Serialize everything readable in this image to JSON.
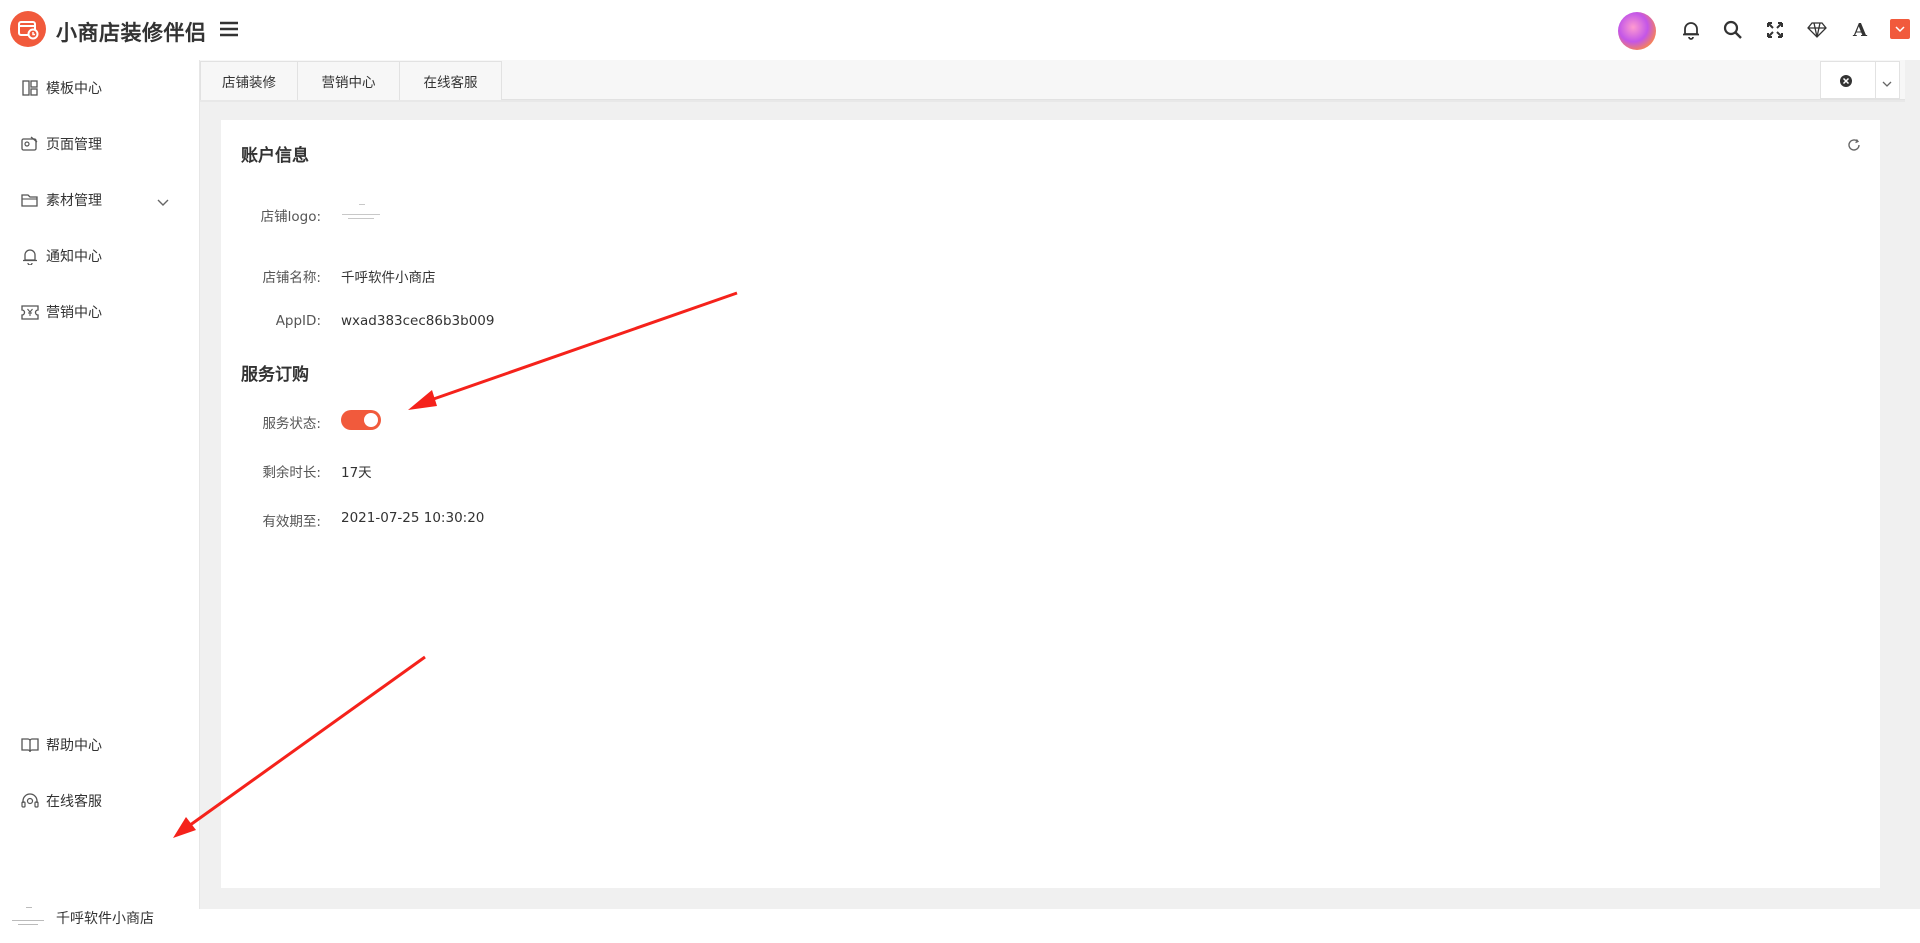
{
  "app": {
    "title": "小商店装修伴侣",
    "accent": "#f15a3c"
  },
  "header": {
    "icons": [
      "menu-toggle-icon",
      "avatar",
      "bell-icon",
      "search-icon",
      "fullscreen-icon",
      "diamond-icon",
      "font-icon",
      "theme-color-icon"
    ]
  },
  "sidebar": {
    "items": [
      {
        "label": "模板中心",
        "icon": "template-icon"
      },
      {
        "label": "页面管理",
        "icon": "page-icon"
      },
      {
        "label": "素材管理",
        "icon": "folder-icon",
        "has_children": true
      },
      {
        "label": "通知中心",
        "icon": "bell-icon"
      },
      {
        "label": "营销中心",
        "icon": "coupon-icon"
      }
    ],
    "bottom": [
      {
        "label": "帮助中心",
        "icon": "book-icon"
      },
      {
        "label": "在线客服",
        "icon": "headset-icon"
      }
    ],
    "store": {
      "name": "千呼软件小商店"
    }
  },
  "tabs": [
    {
      "label": "店铺装修"
    },
    {
      "label": "营销中心"
    },
    {
      "label": "在线客服"
    }
  ],
  "account": {
    "title": "账户信息",
    "logo_label": "店铺logo:",
    "name_label": "店铺名称:",
    "name_value": "千呼软件小商店",
    "appid_label": "AppID:",
    "appid_value": "wxad383cec86b3b009"
  },
  "service": {
    "title": "服务订购",
    "status_label": "服务状态:",
    "status_on": true,
    "remaining_label": "剩余时长:",
    "remaining_value": "17天",
    "expire_label": "有效期至:",
    "expire_value": "2021-07-25 10:30:20"
  },
  "annotations": {
    "arrow_color": "#f5221b"
  }
}
